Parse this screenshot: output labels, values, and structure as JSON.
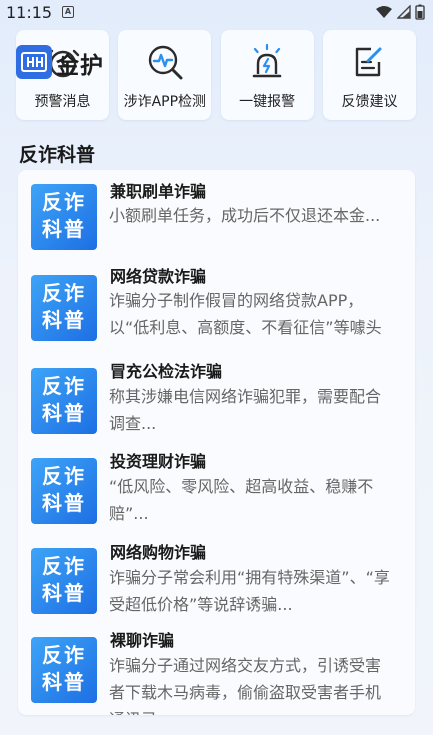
{
  "status_bar": {
    "time": "11:15",
    "notification_glyph": "A"
  },
  "logo": {
    "badge_text": "QH",
    "text": "金护"
  },
  "quick_actions": [
    {
      "label": "预警消息",
      "icon": "alarm-clock-icon"
    },
    {
      "label": "涉诈APP检测",
      "icon": "search-pulse-icon"
    },
    {
      "label": "一键报警",
      "icon": "siren-icon"
    },
    {
      "label": "反馈建议",
      "icon": "edit-note-icon"
    }
  ],
  "section": {
    "title": "反诈科普"
  },
  "thumb_text": {
    "line1": "反诈",
    "line2": "科普"
  },
  "articles": [
    {
      "title": "兼职刷单诈骗",
      "desc": "小额刷单任务，成功后不仅退还本金..."
    },
    {
      "title": "网络贷款诈骗",
      "desc": "诈骗分子制作假冒的网络贷款APP，以“低利息、高额度、不看征信”等噱头"
    },
    {
      "title": "冒充公检法诈骗",
      "desc": "称其涉嫌电信网络诈骗犯罪，需要配合调查..."
    },
    {
      "title": "投资理财诈骗",
      "desc": "“低风险、零风险、超高收益、稳赚不赔”..."
    },
    {
      "title": "网络购物诈骗",
      "desc": "诈骗分子常会利用“拥有特殊渠道”、“享受超低价格”等说辞诱骗..."
    },
    {
      "title": "裸聊诈骗",
      "desc": "诈骗分子通过网络交友方式，引诱受害者下载木马病毒，偷偷盗取受害者手机通讯录"
    }
  ]
}
